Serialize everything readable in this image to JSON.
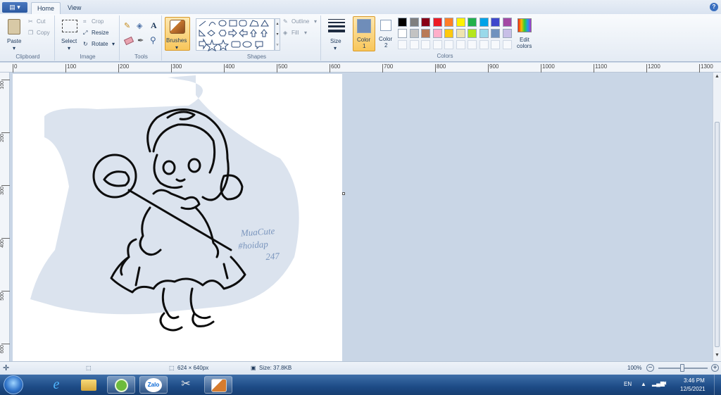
{
  "ribbon_tabs": {
    "home": "Home",
    "view": "View"
  },
  "clipboard": {
    "paste": "Paste",
    "cut": "Cut",
    "copy": "Copy",
    "label": "Clipboard"
  },
  "image": {
    "select": "Select",
    "crop": "Crop",
    "resize": "Resize",
    "rotate": "Rotate",
    "label": "Image"
  },
  "tools": {
    "label": "Tools",
    "text_tool": "A"
  },
  "brushes": {
    "label": "Brushes"
  },
  "shapes": {
    "outline": "Outline",
    "fill": "Fill",
    "label": "Shapes"
  },
  "size": {
    "label": "Size"
  },
  "color1": {
    "label": "Color",
    "num": "1",
    "value": "#6f8db9"
  },
  "color2": {
    "label": "Color",
    "num": "2",
    "value": "#ffffff"
  },
  "colors_label": "Colors",
  "edit_colors": {
    "line1": "Edit",
    "line2": "colors"
  },
  "palette_row1": [
    "#000000",
    "#7f7f7f",
    "#880015",
    "#ed1c24",
    "#ff7f27",
    "#fff200",
    "#22b14c",
    "#00a2e8",
    "#3f48cc",
    "#a349a4"
  ],
  "palette_row2": [
    "#ffffff",
    "#c3c3c3",
    "#b97a57",
    "#ffaec9",
    "#ffc90e",
    "#efe4b0",
    "#b5e61d",
    "#99d9ea",
    "#7092be",
    "#c8bfe7"
  ],
  "ruler_h": [
    "0",
    "100",
    "200",
    "300",
    "400",
    "500",
    "600",
    "700",
    "800",
    "900",
    "1000",
    "1100",
    "1200",
    "1300"
  ],
  "ruler_v": [
    "100",
    "200",
    "300",
    "400",
    "500",
    "600"
  ],
  "canvas_text": {
    "line1": "MuaCute",
    "line2": "#hoidap",
    "line3": "247"
  },
  "status": {
    "dimensions": "624 × 640px",
    "size": "Size: 37.8KB",
    "zoom": "100%"
  },
  "tray": {
    "lang": "EN",
    "time": "3:46 PM",
    "date": "12/5/2021"
  },
  "taskbar_apps": [
    "start-orb-icon",
    "internet-explorer-icon",
    "file-explorer-icon",
    "green-app-icon",
    "zalo-icon",
    "snipping-tool-icon",
    "paint-icon"
  ],
  "taskbar_labels": {
    "zalo": "Zalo"
  }
}
